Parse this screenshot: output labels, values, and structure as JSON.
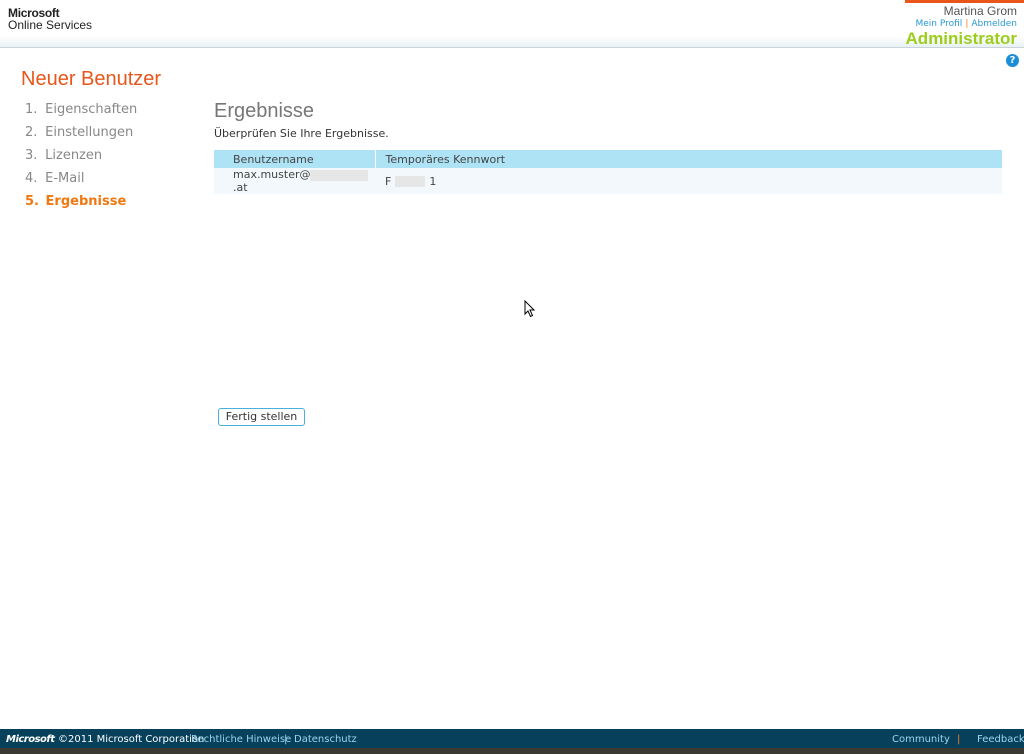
{
  "header": {
    "logo_line1": "Microsoft",
    "logo_line2": "Online Services",
    "user_name": "Martina Grom",
    "profile_link": "Mein Profil",
    "separator": "|",
    "logout_link": "Abmelden",
    "role": "Administrator",
    "help": "?"
  },
  "wizard": {
    "title": "Neuer Benutzer",
    "steps": [
      {
        "num": "1.",
        "label": "Eigenschaften"
      },
      {
        "num": "2.",
        "label": "Einstellungen"
      },
      {
        "num": "3.",
        "label": "Lizenzen"
      },
      {
        "num": "4.",
        "label": "E-Mail"
      },
      {
        "num": "5.",
        "label": "Ergebnisse"
      }
    ]
  },
  "main": {
    "heading": "Ergebnisse",
    "subtitle": "Überprüfen Sie Ihre Ergebnisse.",
    "columns": [
      "Benutzername",
      "Temporäres Kennwort"
    ],
    "row": {
      "user_prefix": "max.muster@",
      "user_suffix": ".at",
      "pw_prefix": "F",
      "pw_suffix": "1"
    },
    "finish_button": "Fertig stellen"
  },
  "footer": {
    "logo": "Microsoft",
    "copyright": "©2011 Microsoft Corporation",
    "legal": "Rechtliche Hinweise",
    "sep": "|",
    "privacy": "Datenschutz",
    "community": "Community",
    "sep2": "|",
    "feedback": "Feedback"
  },
  "colors": {
    "accent": "#e8561c",
    "role": "#9bcd1a",
    "footer": "#06405a",
    "table_header": "#aee3f6"
  }
}
